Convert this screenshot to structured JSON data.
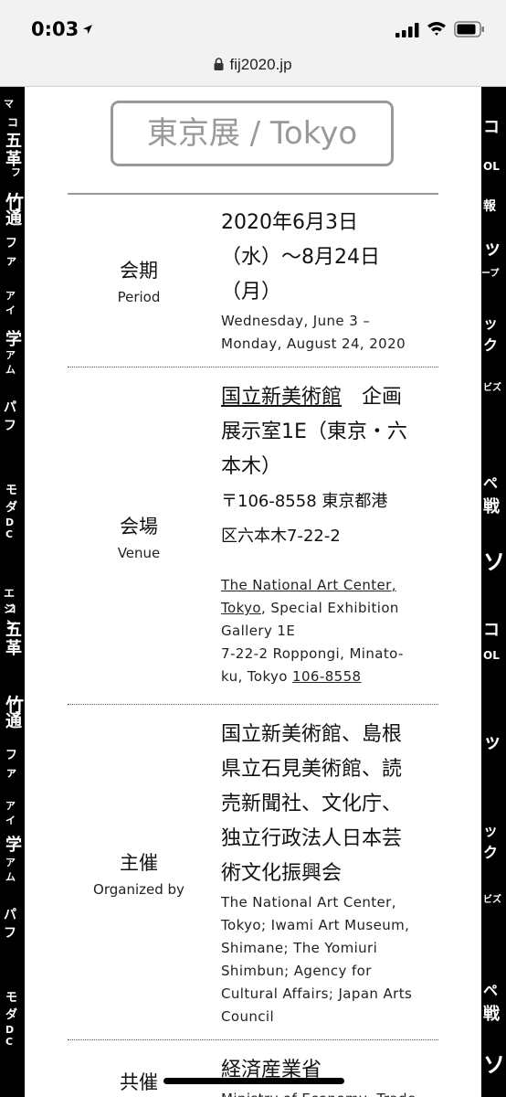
{
  "status": {
    "time": "0:03"
  },
  "browser": {
    "url": "fij2020.jp"
  },
  "title": "東京展 / Tokyo",
  "rows": {
    "period": {
      "label_jp": "会期",
      "label_en": "Period",
      "jp_lines": [
        "2020年6月3日",
        "（水）〜8月24日",
        "（月）"
      ],
      "en_lines": [
        "Wednesday, June 3 –",
        "Monday, August 24, 2020"
      ]
    },
    "venue": {
      "label_jp": "会場",
      "label_en": "Venue",
      "jp_link": "国立新美術館",
      "jp_line1_rest": "　企画",
      "jp_lines": [
        "展示室1E（東京・六",
        "本木）"
      ],
      "jp_addr": [
        "〒106-8558 東京都港",
        "区六本木7-22-2"
      ],
      "en_link_1": "The National Art Center,",
      "en_link_2": "Tokyo",
      "en_line2_rest": ", Special Exhibition",
      "en_lines": [
        "Gallery 1E",
        "7-22-2 Roppongi, Minato-"
      ],
      "en_last_prefix": "ku, Tokyo ",
      "en_last_link": "106-8558"
    },
    "organizer": {
      "label_jp": "主催",
      "label_en": "Organized by",
      "jp_lines": [
        "国立新美術館、島根",
        "県立石見美術館、読",
        "売新聞社、文化庁、",
        "独立行政法人日本芸",
        "術文化振興会"
      ],
      "en_lines": [
        "The National Art Center,",
        "Tokyo; Iwami Art Museum,",
        "Shimane; The Yomiuri",
        "Shimbun; Agency for",
        "Cultural Affairs; Japan Arts",
        "Council"
      ]
    },
    "cosponsor": {
      "label_jp": "共催",
      "jp_link": "経済産業省",
      "en_partial": "Ministry of Economy, Trade"
    }
  },
  "strip_chars": [
    "コ",
    "五",
    "革",
    "フ",
    "竹",
    "通",
    "フ",
    "ア",
    "学",
    "パ",
    "マ",
    "モ",
    "D",
    "エ",
    "ン",
    "ジ",
    "ー",
    "L",
    "報",
    "ッ",
    "ク",
    "ペ",
    "戦",
    "ン"
  ]
}
